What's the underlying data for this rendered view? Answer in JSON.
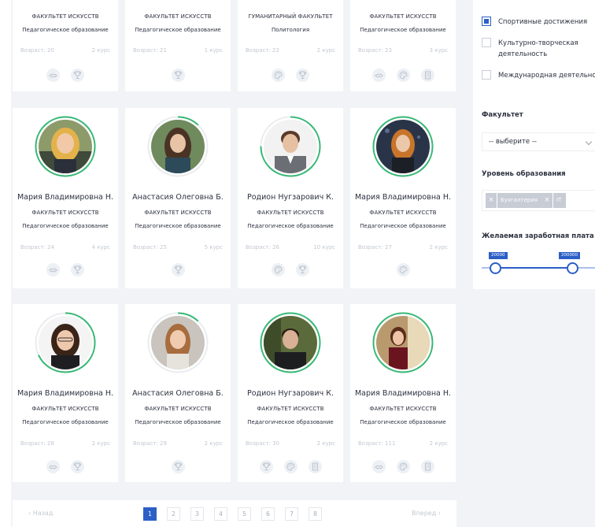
{
  "row1": [
    {
      "faculty": "ФАКУЛЬТЕТ ИСКУССТВ",
      "program": "Педагогическое образование",
      "age": "Возраст: 20",
      "course": "2 курс",
      "icons": [
        "handshake-icon",
        "trophy-icon"
      ]
    },
    {
      "faculty": "ФАКУЛЬТЕТ ИСКУССТВ",
      "program": "Педагогическое образование",
      "age": "Возраст: 21",
      "course": "1 курс",
      "icons": [
        "trophy-icon"
      ]
    },
    {
      "faculty": "ГУМАНИТАРНЫЙ ФАКУЛЬТЕТ",
      "program": "Политология",
      "age": "Возраст: 22",
      "course": "2 курс",
      "icons": [
        "palette-icon",
        "trophy-icon"
      ]
    },
    {
      "faculty": "ФАКУЛЬТЕТ ИСКУССТВ",
      "program": "Педагогическое образование",
      "age": "Возраст: 23",
      "course": "3 курс",
      "icons": [
        "handshake-icon",
        "palette-icon",
        "building-icon"
      ]
    }
  ],
  "row2": [
    {
      "name": "Мария Владимировна Н.",
      "faculty": "ФАКУЛЬТЕТ ИСКУССТВ",
      "program": "Педагогическое образование",
      "age": "Возраст: 24",
      "course": "4 курс",
      "icons": [
        "handshake-icon",
        "trophy-icon"
      ],
      "ring": "#36b874",
      "progress": 1.0
    },
    {
      "name": "Анастасия Олеговна Б.",
      "faculty": "ФАКУЛЬТЕТ ИСКУССТВ",
      "program": "Педагогическое образование",
      "age": "Возраст: 25",
      "course": "5 курс",
      "icons": [
        "trophy-icon"
      ],
      "ring": "#36b874",
      "progress": 0.12
    },
    {
      "name": "Родион Нугзарович К.",
      "faculty": "ФАКУЛЬТЕТ ИСКУССТВ",
      "program": "Педагогическое образование",
      "age": "Возраст: 26",
      "course": "10 курс",
      "icons": [
        "palette-icon",
        "trophy-icon"
      ],
      "ring": "#36b874",
      "progress": 0.75
    },
    {
      "name": "Мария Владимировна Н.",
      "faculty": "ФАКУЛЬТЕТ ИСКУССТВ",
      "program": "Педагогическое образование",
      "age": "Возраст: 27",
      "course": "2 курс",
      "icons": [
        "palette-icon"
      ],
      "ring": "#36b874",
      "progress": 1.0
    }
  ],
  "row3": [
    {
      "name": "Мария Владимировна Н.",
      "faculty": "ФАКУЛЬТЕТ ИСКУССТВ",
      "program": "Педагогическое образование",
      "age": "Возраст: 28",
      "course": "2 курс",
      "icons": [
        "handshake-icon",
        "trophy-icon"
      ],
      "ring": "#36b874",
      "progress": 0.68
    },
    {
      "name": "Анастасия Олеговна Б.",
      "faculty": "ФАКУЛЬТЕТ ИСКУССТВ",
      "program": "Педагогическое образование",
      "age": "Возраст: 29",
      "course": "2 курс",
      "icons": [
        "trophy-icon"
      ],
      "ring": "#36b874",
      "progress": 0.12
    },
    {
      "name": "Родион Нугзарович К.",
      "faculty": "ФАКУЛЬТЕТ ИСКУССТВ",
      "program": "Педагогическое образование",
      "age": "Возраст: 30",
      "course": "2 курс",
      "icons": [
        "trophy-icon",
        "palette-icon",
        "building-icon"
      ],
      "ring": "#36b874",
      "progress": 1.0
    },
    {
      "name": "Мария Владимировна Н.",
      "faculty": "ФАКУЛЬТЕТ ИСКУССТВ",
      "program": "Педагогическое образование",
      "age": "Возраст: 111",
      "course": "2 курс",
      "icons": [
        "handshake-icon",
        "palette-icon",
        "building-icon"
      ],
      "ring": "#36b874",
      "progress": 1.0
    }
  ],
  "filters": {
    "activities": [
      {
        "label": "Спортивные достижения",
        "checked": true
      },
      {
        "label": "Культурно-творческая деятельность",
        "checked": false
      },
      {
        "label": "Международная деятельность",
        "checked": false
      }
    ],
    "faculty_title": "Факультет",
    "faculty_placeholder": "-- выберите --",
    "level_title": "Уровень образования",
    "level_tags": [
      "Бухгалтерия",
      "IT"
    ],
    "salary_title": "Желаемая заработная плата",
    "salary_min": "20000",
    "salary_max": "200000"
  },
  "pagination": {
    "prev": "Назад",
    "next": "Вперед",
    "pages": [
      "1",
      "2",
      "3",
      "4",
      "5",
      "6",
      "7",
      "8"
    ],
    "current": "1"
  },
  "colors": {
    "accent": "#2b5fc6",
    "ring": "#36b874",
    "muted": "#c2c8d2"
  }
}
